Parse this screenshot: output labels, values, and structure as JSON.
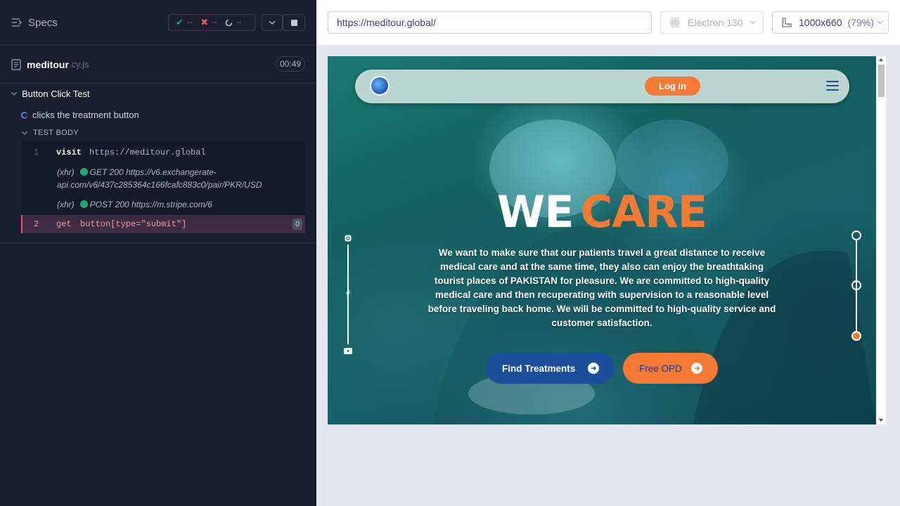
{
  "runner": {
    "specs_label": "Specs",
    "stats": {
      "passed": "--",
      "failed": "--",
      "pending": "--"
    },
    "spec_file": {
      "name": "meditour",
      "ext": ".cy.js",
      "duration": "00:49"
    },
    "suite_title": "Button Click Test",
    "test_title": "clicks the treatment button",
    "test_body_label": "TEST BODY",
    "commands": [
      {
        "num": "1",
        "name": "visit",
        "arg": "https://meditour.global"
      },
      {
        "num": "2",
        "name": "get",
        "arg": "button[type=\"submit\"]",
        "badge": "0"
      }
    ],
    "xhr": [
      {
        "kind": "(xhr)",
        "method": "GET",
        "status": "200",
        "url_line1": "https://v6.exchangerate-",
        "url_line2": "api.com/v6/437c285364c166fcafc883c0/pair/PKR/USD"
      },
      {
        "kind": "(xhr)",
        "method": "POST",
        "status": "200",
        "url_line1": "https://m.stripe.com/6"
      }
    ]
  },
  "browser": {
    "url": "https://meditour.global/",
    "engine": "Electron 130",
    "viewport": "1000x660",
    "viewport_display": "1000x660",
    "zoom": "(79%)"
  },
  "site": {
    "login_label": "Log In",
    "hero_word1": "WE",
    "hero_word2": "CARE",
    "hero_text": "We want to make sure that our patients travel a great distance to receive medical care and at the same time, they also can enjoy the breathtaking tourist places of PAKISTAN for pleasure. We are committed to high-quality medical care and then recuperating with supervision to a reasonable level before traveling back home. We will be committed to high-quality service and customer satisfaction.",
    "find_label": "Find Treatments",
    "opd_label": "Free OPD"
  },
  "colors": {
    "accent_orange": "#f47a34",
    "accent_blue": "#1b4f9c",
    "runner_bg": "#1b1e2e",
    "failing_row": "#3d2c44"
  }
}
